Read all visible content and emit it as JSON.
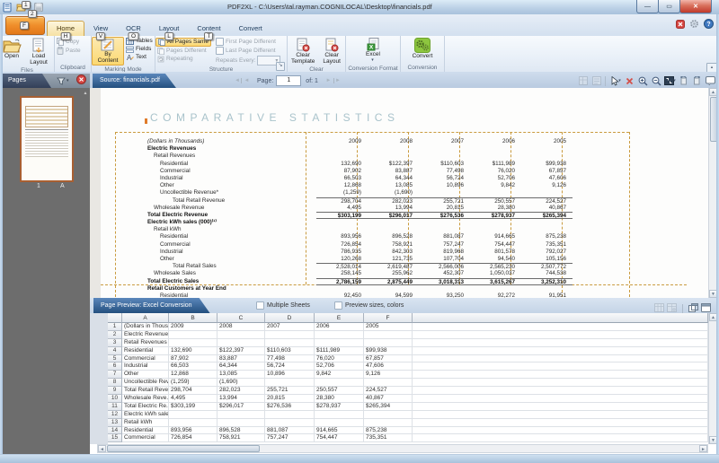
{
  "window": {
    "title": "PDF2XL - C:\\Users\\tal.rayman.COGNILOCAL\\Desktop\\financials.pdf"
  },
  "qat": {
    "keytip_open": "1",
    "keytip_save": "2"
  },
  "ribbon": {
    "file_keytip": "F",
    "active_tab": "Home",
    "tabs": [
      {
        "label": "Home",
        "keytip": "H"
      },
      {
        "label": "View",
        "keytip": "V"
      },
      {
        "label": "OCR",
        "keytip": "O"
      },
      {
        "label": "Layout",
        "keytip": "L"
      },
      {
        "label": "Content",
        "keytip": "T"
      },
      {
        "label": "Convert",
        "keytip": ""
      }
    ],
    "files": {
      "label": "Files",
      "open": "Open",
      "load_layout": "Load Layout"
    },
    "clipboard": {
      "label": "Clipboard",
      "copy": "Copy",
      "paste": "Paste"
    },
    "marking": {
      "label": "Marking Mode",
      "by_content": "By Content",
      "tables": "Tables",
      "fields": "Fields",
      "text": "Text"
    },
    "structure": {
      "label": "Structure",
      "all_pages_same": "All Pages Same",
      "pages_different": "Pages Different",
      "repeating": "Repeating",
      "first_page_different": "First Page Different",
      "last_page_different": "Last Page Different",
      "repeats_every": "Repeats Every:"
    },
    "clear": {
      "label": "Clear",
      "clear_template": "Clear Template",
      "clear_layout": "Clear Layout"
    },
    "conversion_format": {
      "label": "Conversion Format",
      "excel": "Excel"
    },
    "conversion": {
      "label": "Conversion",
      "convert": "Convert"
    }
  },
  "pages_panel": {
    "title": "Pages",
    "page_number": "1",
    "page_letter": "A"
  },
  "doc": {
    "source_tab": "Source: financials.pdf",
    "page_label": "Page:",
    "page_value": "1",
    "of_label": "of: 1",
    "title": "COMPARATIVE STATISTICS",
    "table": {
      "unit_label": "(Dollars in Thousands)",
      "years": [
        "2009",
        "2008",
        "2007",
        "2006",
        "2005"
      ],
      "rows": [
        {
          "label": "Electric Revenues",
          "b": true,
          "i": 0
        },
        {
          "label": "Retail Revenues",
          "i": 1
        },
        {
          "label": "Residential",
          "i": 2,
          "v": [
            "132,690",
            "$122,397",
            "$110,603",
            "$111,989",
            "$99,938"
          ]
        },
        {
          "label": "Commercial",
          "i": 2,
          "v": [
            "87,902",
            "83,887",
            "77,498",
            "76,020",
            "67,857"
          ]
        },
        {
          "label": "Industrial",
          "i": 2,
          "v": [
            "66,503",
            "64,344",
            "56,724",
            "52,706",
            "47,606"
          ]
        },
        {
          "label": "Other",
          "i": 2,
          "v": [
            "12,868",
            "13,085",
            "10,896",
            "9,842",
            "9,126"
          ]
        },
        {
          "label": "Uncollectible Revenue*",
          "i": 2,
          "v": [
            "(1,259)",
            "(1,690)",
            "",
            "",
            ""
          ]
        },
        {
          "label": "Total Retail Revenue",
          "i": 3,
          "la": true,
          "v": [
            "298,704",
            "282,023",
            "255,721",
            "250,557",
            "224,527"
          ]
        },
        {
          "label": "Wholesale Revenue",
          "i": 1,
          "v": [
            "4,495",
            "13,994",
            "20,815",
            "28,380",
            "40,867"
          ]
        },
        {
          "label": "Total Electric Revenue",
          "b": true,
          "i": 0,
          "la": true,
          "lb": true,
          "v": [
            "$303,199",
            "$296,017",
            "$276,536",
            "$278,937",
            "$265,394"
          ]
        },
        {
          "label": "Electric kWh sales (000)⁽¹⁾",
          "b": true,
          "i": 0
        },
        {
          "label": "Retail kWh",
          "i": 1
        },
        {
          "label": "Residential",
          "i": 2,
          "v": [
            "893,956",
            "896,528",
            "881,087",
            "914,665",
            "875,238"
          ]
        },
        {
          "label": "Commercial",
          "i": 2,
          "v": [
            "726,854",
            "758,921",
            "757,247",
            "754,447",
            "735,351"
          ]
        },
        {
          "label": "Industrial",
          "i": 2,
          "v": [
            "786,935",
            "842,303",
            "819,968",
            "801,578",
            "792,027"
          ]
        },
        {
          "label": "Other",
          "i": 2,
          "v": [
            "120,268",
            "121,735",
            "107,704",
            "94,540",
            "105,156"
          ]
        },
        {
          "label": "Total Retail Sales",
          "i": 3,
          "la": true,
          "v": [
            "2,528,014",
            "2,619,487",
            "2,566,006",
            "2,565,230",
            "2,507,772"
          ]
        },
        {
          "label": "Wholesale Sales",
          "i": 1,
          "v": [
            "258,145",
            "255,962",
            "452,307",
            "1,050,037",
            "744,538"
          ]
        },
        {
          "label": "Total Electric Sales",
          "b": true,
          "i": 0,
          "la": true,
          "lb": true,
          "v": [
            "2,786,159",
            "2,875,449",
            "3,018,313",
            "3,615,267",
            "3,252,310"
          ]
        },
        {
          "label": "Retail Customers at Year End",
          "b": true,
          "i": 0
        },
        {
          "label": "Residential",
          "i": 2,
          "v": [
            "92,450",
            "94,599",
            "93,250",
            "92,272",
            "91,951"
          ]
        }
      ]
    }
  },
  "preview": {
    "tab": "Page Preview: Excel Conversion",
    "multiple_sheets": "Multiple Sheets",
    "preview_sizes": "Preview sizes, colors",
    "columns": [
      "A",
      "B",
      "C",
      "D",
      "E",
      "F"
    ],
    "rows": [
      {
        "n": "1",
        "cells": [
          "(Dollars in Thous...",
          "2009",
          "2008",
          "2007",
          "2006",
          "2005"
        ]
      },
      {
        "n": "2",
        "cells": [
          "Electric Revenues",
          "",
          "",
          "",
          "",
          ""
        ]
      },
      {
        "n": "3",
        "cells": [
          "Retail Revenues",
          "",
          "",
          "",
          "",
          ""
        ]
      },
      {
        "n": "4",
        "cells": [
          "Residential",
          "132,690",
          "$122,397",
          "$110,603",
          "$111,989",
          "$99,938"
        ]
      },
      {
        "n": "5",
        "cells": [
          "Commercial",
          "87,902",
          "83,887",
          "77,498",
          "76,020",
          "67,857"
        ]
      },
      {
        "n": "6",
        "cells": [
          "Industrial",
          "66,503",
          "64,344",
          "56,724",
          "52,706",
          "47,606"
        ]
      },
      {
        "n": "7",
        "cells": [
          "Other",
          "12,868",
          "13,085",
          "10,896",
          "9,842",
          "9,126"
        ]
      },
      {
        "n": "8",
        "cells": [
          "Uncollectible Rev...",
          "(1,259)",
          "(1,690)",
          "",
          "",
          ""
        ]
      },
      {
        "n": "9",
        "cells": [
          "Total Retail Reve...",
          "298,704",
          "282,023",
          "255,721",
          "250,557",
          "224,527"
        ]
      },
      {
        "n": "10",
        "cells": [
          "Wholesale Reve...",
          "4,495",
          "13,994",
          "20,815",
          "28,380",
          "40,867"
        ]
      },
      {
        "n": "11",
        "cells": [
          "Total Electric Re...",
          "$303,199",
          "$296,017",
          "$276,536",
          "$278,937",
          "$265,394"
        ]
      },
      {
        "n": "12",
        "cells": [
          "Electric kWh sale...",
          "",
          "",
          "",
          "",
          ""
        ]
      },
      {
        "n": "13",
        "cells": [
          "Retail kWh",
          "",
          "",
          "",
          "",
          ""
        ]
      },
      {
        "n": "14",
        "cells": [
          "Residential",
          "893,956",
          "896,528",
          "881,087",
          "914,665",
          "875,238"
        ]
      },
      {
        "n": "15",
        "cells": [
          "Commercial",
          "726,854",
          "758,921",
          "757,247",
          "754,447",
          "735,351"
        ]
      }
    ]
  }
}
